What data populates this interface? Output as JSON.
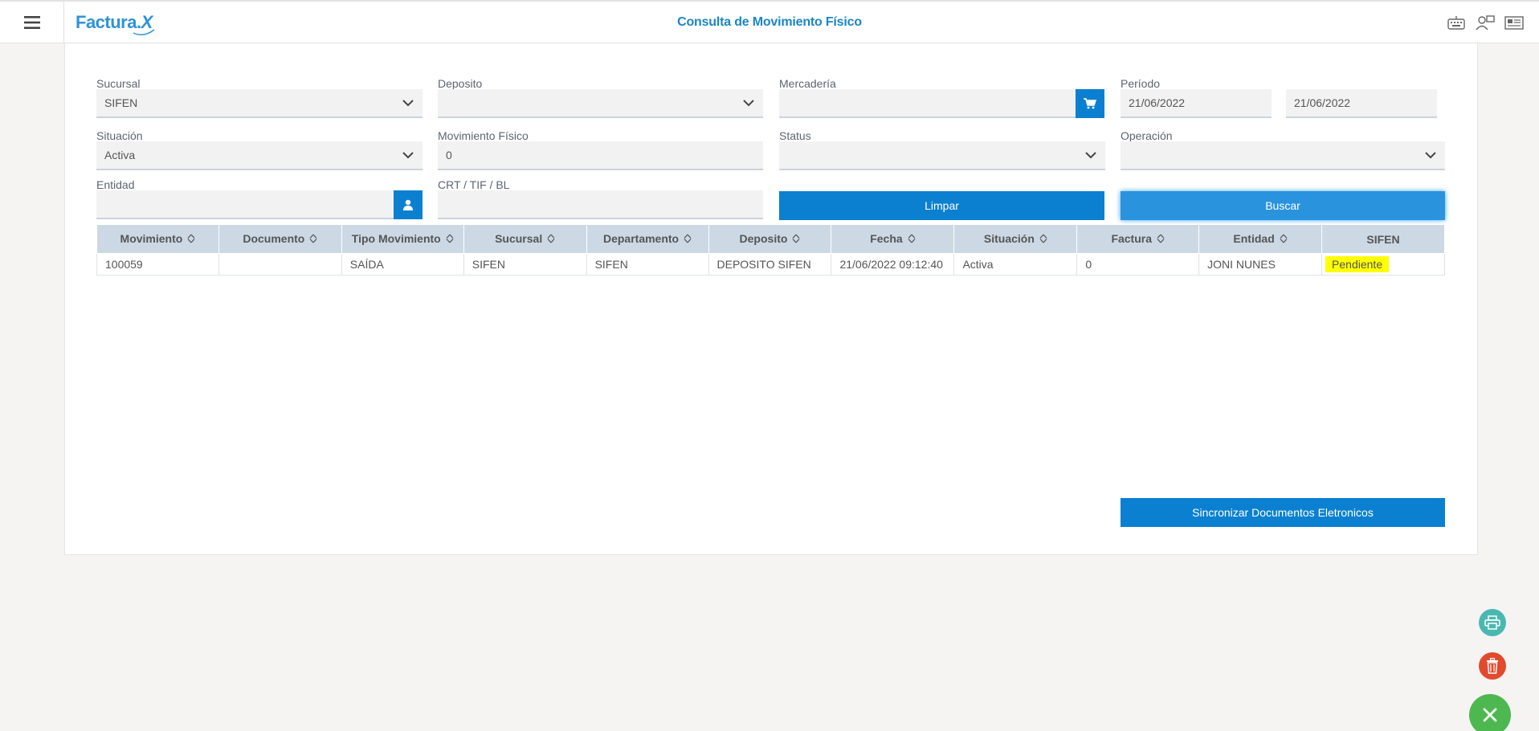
{
  "header": {
    "logo_text": "Factura",
    "logo_x": "X",
    "title": "Consulta de Movimiento Físico",
    "icons": [
      "keyboard-icon",
      "users-icon",
      "newspaper-icon"
    ]
  },
  "filters": {
    "sucursal": {
      "label": "Sucursal",
      "value": "SIFEN"
    },
    "deposito": {
      "label": "Deposito",
      "value": ""
    },
    "mercaderia": {
      "label": "Mercadería",
      "value": ""
    },
    "periodo": {
      "label": "Período",
      "from": "21/06/2022",
      "to": "21/06/2022"
    },
    "situacion": {
      "label": "Situación",
      "value": "Activa"
    },
    "movimiento_fisico": {
      "label": "Movimiento Físico",
      "value": "0"
    },
    "status": {
      "label": "Status",
      "value": ""
    },
    "operacion": {
      "label": "Operación",
      "value": ""
    },
    "entidad": {
      "label": "Entidad",
      "value": ""
    },
    "crt": {
      "label": "CRT / TIF / BL",
      "value": ""
    }
  },
  "buttons": {
    "limpar": "Limpar",
    "buscar": "Buscar",
    "sincronizar": "Sincronizar Documentos Eletronicos"
  },
  "table": {
    "columns": [
      "Movimiento",
      "Documento",
      "Tipo Movimiento",
      "Sucursal",
      "Departamento",
      "Deposito",
      "Fecha",
      "Situación",
      "Factura",
      "Entidad",
      "SIFEN"
    ],
    "rows": [
      [
        "100059",
        "",
        "SAÍDA",
        "SIFEN",
        "SIFEN",
        "DEPOSITO SIFEN",
        "21/06/2022 09:12:40",
        "Activa",
        "0",
        "JONI NUNES",
        "Pendiente"
      ]
    ]
  },
  "colors": {
    "accent": "#0b80d0",
    "title": "#1a86c8",
    "header_row": "#ccd9e5",
    "badge": "#ffff00",
    "print_fab": "#4ab8b0",
    "delete_fab": "#e24a2e",
    "close_fab": "#4db84f"
  }
}
